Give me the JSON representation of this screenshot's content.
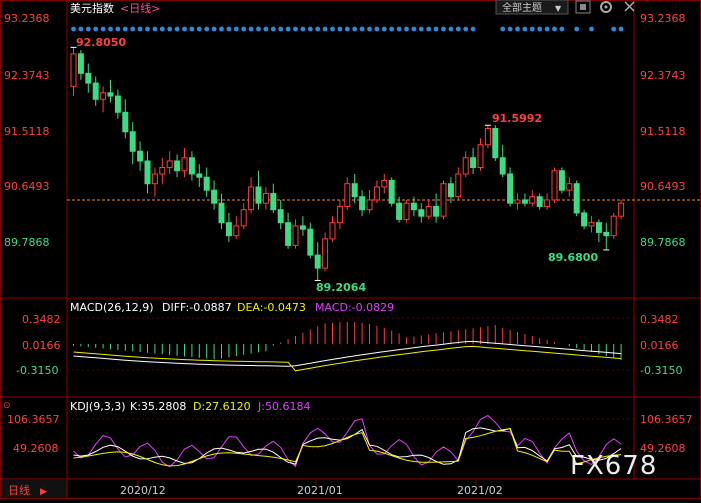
{
  "header": {
    "title": "美元指数",
    "period_link": "<日线>",
    "dropdown_label": "全部主题",
    "dropdown_arrow": "▼"
  },
  "price_panel": {
    "axis_ticks": [
      "93.2368",
      "92.3743",
      "91.5118",
      "90.6493",
      "89.7868"
    ],
    "annotations": {
      "high1": "92.8050",
      "high2": "91.5992",
      "low1": "89.2064",
      "low2": "89.6800"
    }
  },
  "macd_panel": {
    "title": "MACD(26,12,9)",
    "diff": "DIFF:-0.0887",
    "dea": "DEA:-0.0473",
    "macd": "MACD:-0.0829",
    "axis_ticks": [
      "0.3482",
      "0.0166",
      "-0.3150"
    ]
  },
  "kdj_panel": {
    "title": "KDJ(9,3,3)",
    "k": "K:35.2808",
    "d": "D:27.6120",
    "j": "J:50.6184",
    "axis_ticks": [
      "106.3657",
      "49.2608"
    ]
  },
  "bottom_bar": {
    "period_label": "日线",
    "x_ticks": [
      "2020/12",
      "2021/01",
      "2021/02"
    ]
  },
  "watermark": "FX678",
  "colors": {
    "up": "#ff3b3b",
    "down": "#3ddc84",
    "dot": "#2a8bd8",
    "diff": "#ffffff",
    "dea": "#f0f000",
    "j": "#e040fb",
    "axis_label": "#ff4040",
    "grid": "#8b0000"
  },
  "chart_data": {
    "type": "candlestick",
    "y_range": [
      89.2064,
      93.2368
    ],
    "ohlc": [
      [
        92.2,
        92.8,
        92.05,
        92.7
      ],
      [
        92.7,
        92.76,
        92.3,
        92.4
      ],
      [
        92.4,
        92.55,
        92.1,
        92.25
      ],
      [
        92.25,
        92.35,
        91.9,
        92.0
      ],
      [
        92.0,
        92.2,
        91.8,
        92.1
      ],
      [
        92.1,
        92.3,
        91.95,
        92.05
      ],
      [
        92.05,
        92.15,
        91.7,
        91.8
      ],
      [
        91.8,
        92.0,
        91.4,
        91.5
      ],
      [
        91.5,
        91.65,
        91.0,
        91.2
      ],
      [
        91.2,
        91.35,
        90.9,
        91.05
      ],
      [
        91.05,
        91.2,
        90.55,
        90.7
      ],
      [
        90.7,
        90.95,
        90.5,
        90.85
      ],
      [
        90.85,
        91.1,
        90.7,
        90.95
      ],
      [
        90.95,
        91.2,
        90.85,
        91.05
      ],
      [
        91.05,
        91.15,
        90.8,
        90.9
      ],
      [
        90.9,
        91.25,
        90.8,
        91.1
      ],
      [
        91.1,
        91.2,
        90.75,
        90.85
      ],
      [
        90.85,
        91.0,
        90.65,
        90.8
      ],
      [
        90.8,
        90.95,
        90.5,
        90.6
      ],
      [
        90.6,
        90.75,
        90.3,
        90.4
      ],
      [
        90.4,
        90.55,
        90.0,
        90.1
      ],
      [
        90.1,
        90.25,
        89.8,
        89.9
      ],
      [
        89.9,
        90.2,
        89.85,
        90.05
      ],
      [
        90.05,
        90.4,
        90.0,
        90.3
      ],
      [
        90.3,
        90.8,
        90.25,
        90.65
      ],
      [
        90.65,
        90.9,
        90.3,
        90.4
      ],
      [
        90.4,
        90.65,
        90.3,
        90.55
      ],
      [
        90.55,
        90.7,
        90.25,
        90.3
      ],
      [
        90.3,
        90.45,
        90.0,
        90.1
      ],
      [
        90.1,
        90.25,
        89.7,
        89.75
      ],
      [
        89.75,
        90.15,
        89.7,
        90.05
      ],
      [
        90.05,
        90.2,
        89.9,
        90.0
      ],
      [
        90.0,
        90.1,
        89.55,
        89.6
      ],
      [
        89.6,
        89.8,
        89.21,
        89.4
      ],
      [
        89.4,
        89.95,
        89.35,
        89.85
      ],
      [
        89.85,
        90.2,
        89.8,
        90.1
      ],
      [
        90.1,
        90.45,
        90.0,
        90.35
      ],
      [
        90.35,
        90.8,
        90.3,
        90.7
      ],
      [
        90.7,
        90.85,
        90.4,
        90.5
      ],
      [
        90.5,
        90.6,
        90.2,
        90.3
      ],
      [
        90.3,
        90.6,
        90.25,
        90.45
      ],
      [
        90.45,
        90.75,
        90.4,
        90.65
      ],
      [
        90.65,
        90.85,
        90.55,
        90.75
      ],
      [
        90.75,
        90.8,
        90.35,
        90.4
      ],
      [
        90.4,
        90.5,
        90.1,
        90.15
      ],
      [
        90.15,
        90.45,
        90.1,
        90.4
      ],
      [
        90.4,
        90.5,
        90.2,
        90.3
      ],
      [
        90.3,
        90.4,
        90.1,
        90.2
      ],
      [
        90.2,
        90.45,
        90.15,
        90.35
      ],
      [
        90.35,
        90.55,
        90.1,
        90.2
      ],
      [
        90.2,
        90.75,
        90.15,
        90.7
      ],
      [
        90.7,
        90.8,
        90.4,
        90.5
      ],
      [
        90.5,
        90.95,
        90.45,
        90.85
      ],
      [
        90.85,
        91.2,
        90.8,
        91.1
      ],
      [
        91.1,
        91.25,
        90.85,
        90.95
      ],
      [
        90.95,
        91.4,
        90.9,
        91.3
      ],
      [
        91.3,
        91.6,
        91.25,
        91.55
      ],
      [
        91.55,
        91.6,
        91.05,
        91.1
      ],
      [
        91.1,
        91.3,
        90.8,
        90.85
      ],
      [
        90.85,
        90.95,
        90.35,
        90.4
      ],
      [
        90.4,
        90.55,
        90.3,
        90.45
      ],
      [
        90.45,
        90.55,
        90.35,
        90.4
      ],
      [
        90.4,
        90.6,
        90.35,
        90.5
      ],
      [
        90.5,
        90.55,
        90.3,
        90.35
      ],
      [
        90.35,
        90.55,
        90.3,
        90.45
      ],
      [
        90.45,
        90.95,
        90.4,
        90.9
      ],
      [
        90.9,
        90.95,
        90.55,
        90.6
      ],
      [
        90.6,
        90.8,
        90.5,
        90.7
      ],
      [
        90.7,
        90.75,
        90.2,
        90.25
      ],
      [
        90.25,
        90.3,
        90.0,
        90.05
      ],
      [
        90.05,
        90.2,
        89.95,
        90.1
      ],
      [
        90.1,
        90.15,
        89.8,
        89.95
      ],
      [
        89.95,
        90.1,
        89.68,
        89.9
      ],
      [
        89.9,
        90.25,
        89.85,
        90.2
      ],
      [
        90.2,
        90.45,
        90.15,
        90.4
      ]
    ]
  }
}
